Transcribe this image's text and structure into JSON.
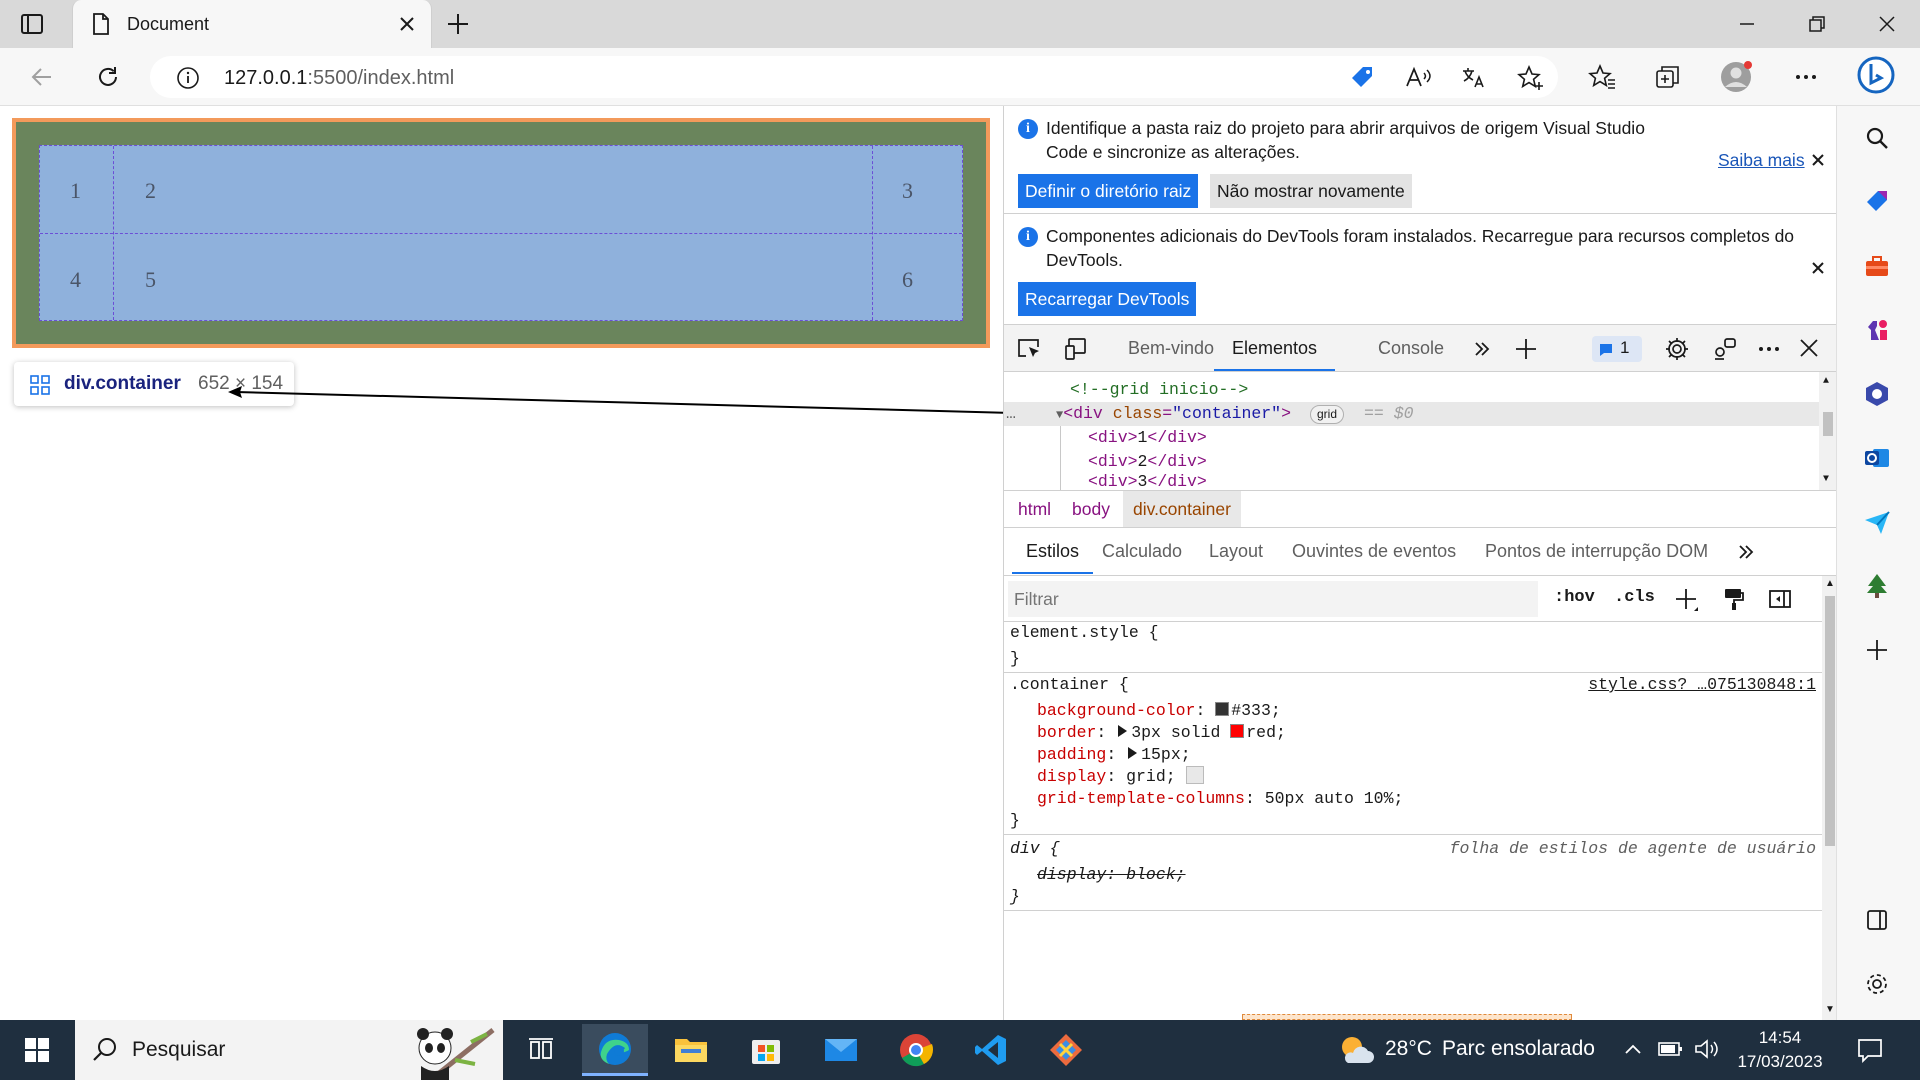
{
  "browser": {
    "tab_title": "Document",
    "url_host": "127.0.0.1",
    "url_rest": ":5500/index.html"
  },
  "page": {
    "grid_cells": [
      "1",
      "2",
      "3",
      "4",
      "5",
      "6"
    ],
    "tooltip": {
      "name": "div.container",
      "size": "652 × 154"
    }
  },
  "devtools": {
    "info1": {
      "text": "Identifique a pasta raiz do projeto para abrir arquivos de origem Visual Studio Code e sincronize as alterações.",
      "learn_more": "Saiba mais",
      "primary_button": "Definir o diretório raiz",
      "secondary_button": "Não mostrar novamente"
    },
    "info2": {
      "text": "Componentes adicionais do DevTools foram instalados. Recarregue para recursos completos do DevTools.",
      "button": "Recarregar DevTools"
    },
    "tabs": [
      "Bem-vindo",
      "Elementos",
      "Console"
    ],
    "active_tab": "Elementos",
    "issues_count": "1",
    "tree": {
      "comment": "<!--grid inicio-->",
      "div_open_tag": "div",
      "div_attr": "class",
      "div_attr_val": "\"container\"",
      "grid_badge": "grid",
      "dollar0": "== $0",
      "children": [
        "1",
        "2",
        "3"
      ]
    },
    "breadcrumb": [
      "html",
      "body",
      "div.container"
    ],
    "styles_tabs": [
      "Estilos",
      "Calculado",
      "Layout",
      "Ouvintes de eventos",
      "Pontos de interrupção DOM"
    ],
    "filter_placeholder": "Filtrar",
    "hov": ":hov",
    "cls": ".cls",
    "styles": {
      "element_style": "element.style {",
      "close": "}",
      "container_selector": ".container {",
      "container_source": "style.css?_…075130848:1",
      "props": [
        {
          "name": "background-color",
          "value": "#333",
          "swatch": "#333333"
        },
        {
          "name": "border",
          "value": "3px solid",
          "value2": "red",
          "swatch": "#ff0000"
        },
        {
          "name": "padding",
          "value": "15px"
        },
        {
          "name": "display",
          "value": "grid"
        },
        {
          "name": "grid-template-columns",
          "value": "50px auto 10%"
        }
      ],
      "div_selector": "div {",
      "div_source": "folha de estilos de agente de usuário",
      "div_prop": "display: block;"
    }
  },
  "taskbar": {
    "search_placeholder": "Pesquisar",
    "weather_temp": "28°C",
    "weather_desc": "Parc ensolarado",
    "time": "14:54",
    "date": "17/03/2023"
  },
  "colors": {
    "accent": "#1a73e8",
    "margin_overlay": "#f39a5b",
    "padding_overlay": "#6a855c",
    "content_overlay": "#8fb1dc"
  }
}
